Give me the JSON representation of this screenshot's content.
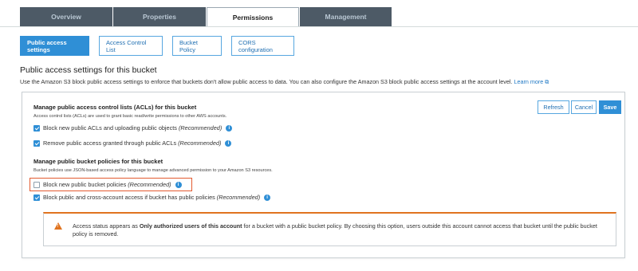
{
  "tabs": [
    {
      "label": "Overview",
      "active": false
    },
    {
      "label": "Properties",
      "active": false
    },
    {
      "label": "Permissions",
      "active": true
    },
    {
      "label": "Management",
      "active": false
    }
  ],
  "subtabs": [
    {
      "label": "Public access settings",
      "active": true
    },
    {
      "label": "Access Control List",
      "active": false
    },
    {
      "label": "Bucket Policy",
      "active": false
    },
    {
      "label": "CORS configuration",
      "active": false
    }
  ],
  "page": {
    "heading": "Public access settings for this bucket",
    "description": "Use the Amazon S3 block public access settings to enforce that buckets don't allow public access to data. You can also configure the Amazon S3 block public access settings at the account level.",
    "learn_more": "Learn more"
  },
  "actions": {
    "refresh": "Refresh",
    "cancel": "Cancel",
    "save": "Save"
  },
  "acl_section": {
    "title": "Manage public access control lists (ACLs) for this bucket",
    "description": "Access control lists (ACLs) are used to grant basic read/write permissions to other AWS accounts.",
    "options": [
      {
        "label": "Block new public ACLs and uploading public objects",
        "recommended": "(Recommended)",
        "checked": true
      },
      {
        "label": "Remove public access granted through public ACLs",
        "recommended": "(Recommended)",
        "checked": true
      }
    ]
  },
  "policy_section": {
    "title": "Manage public bucket policies for this bucket",
    "description": "Bucket policies use JSON-based access policy language to manage advanced permission to your Amazon S3 resources.",
    "options": [
      {
        "label": "Block new public bucket policies",
        "recommended": "(Recommended)",
        "checked": false
      },
      {
        "label": "Block public and cross-account access if bucket has public policies",
        "recommended": "(Recommended)",
        "checked": true
      }
    ]
  },
  "warning": {
    "prefix": "Access status appears as",
    "bold": "Only authorized users of this account",
    "suffix": "for a bucket with a public bucket policy. By choosing this option, users outside this account cannot access that bucket until the public bucket policy is removed."
  },
  "icons": {
    "info": "info-icon",
    "external": "external-link-icon",
    "warning": "warning-icon"
  },
  "colors": {
    "accent": "#2f8fd6",
    "tab_bg": "#4d5a66",
    "warning": "#e0731f",
    "highlight": "#e35b30"
  }
}
